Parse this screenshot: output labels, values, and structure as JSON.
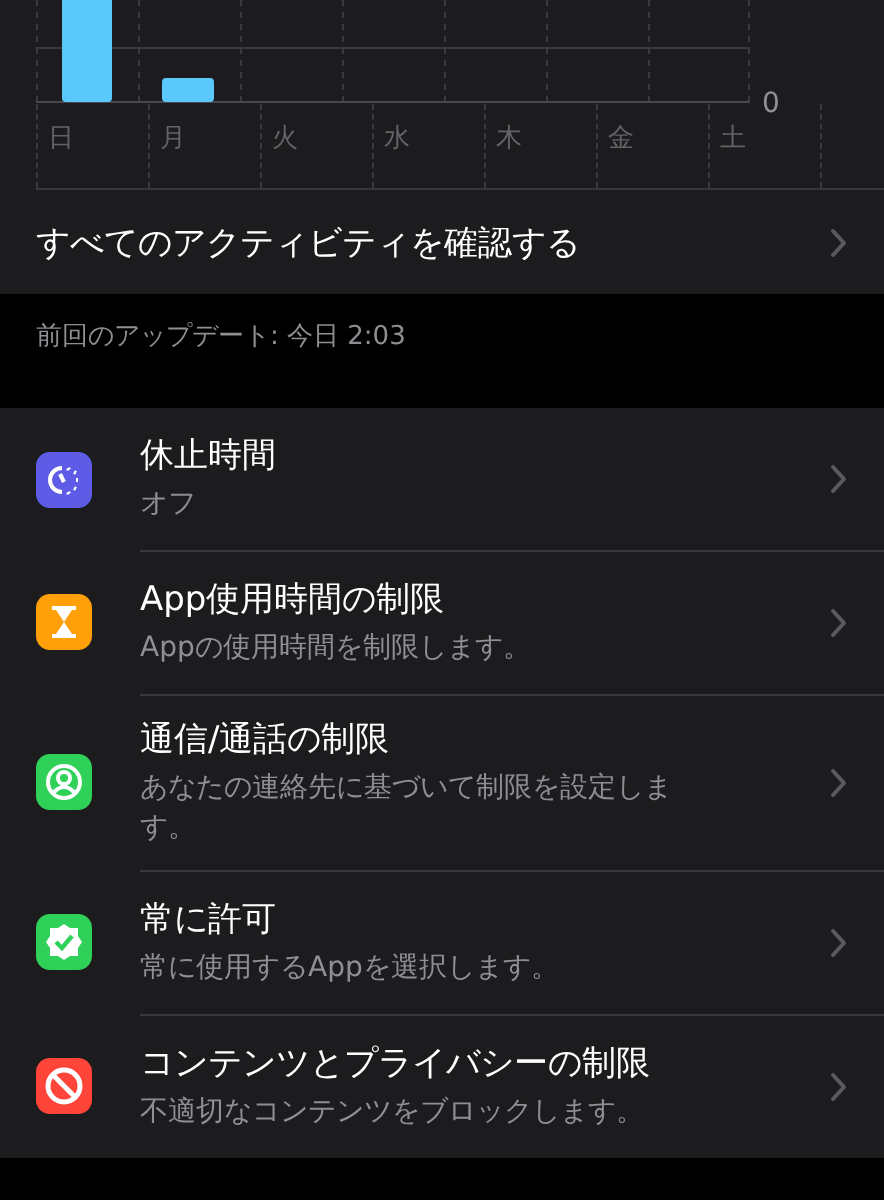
{
  "chart": {
    "days": [
      "日",
      "月",
      "火",
      "水",
      "木",
      "金",
      "土"
    ],
    "y_tick": "0"
  },
  "activity_link": {
    "label": "すべてのアクティビティを確認する"
  },
  "last_update": "前回のアップデート: 今日 2:03",
  "settings": [
    {
      "kind": "downtime",
      "color": "#5e5ce6",
      "title": "休止時間",
      "subtitle": "オフ"
    },
    {
      "kind": "hourglass",
      "color": "#ff9f0a",
      "title": "App使用時間の制限",
      "subtitle": "Appの使用時間を制限します。"
    },
    {
      "kind": "contact",
      "color": "#30d158",
      "title": "通信/通話の制限",
      "subtitle": "あなたの連絡先に基づいて制限を設定します。"
    },
    {
      "kind": "check",
      "color": "#30d158",
      "title": "常に許可",
      "subtitle": "常に使用するAppを選択します。"
    },
    {
      "kind": "block",
      "color": "#ff453a",
      "title": "コンテンツとプライバシーの制限",
      "subtitle": "不適切なコンテンツをブロックします。"
    }
  ]
}
